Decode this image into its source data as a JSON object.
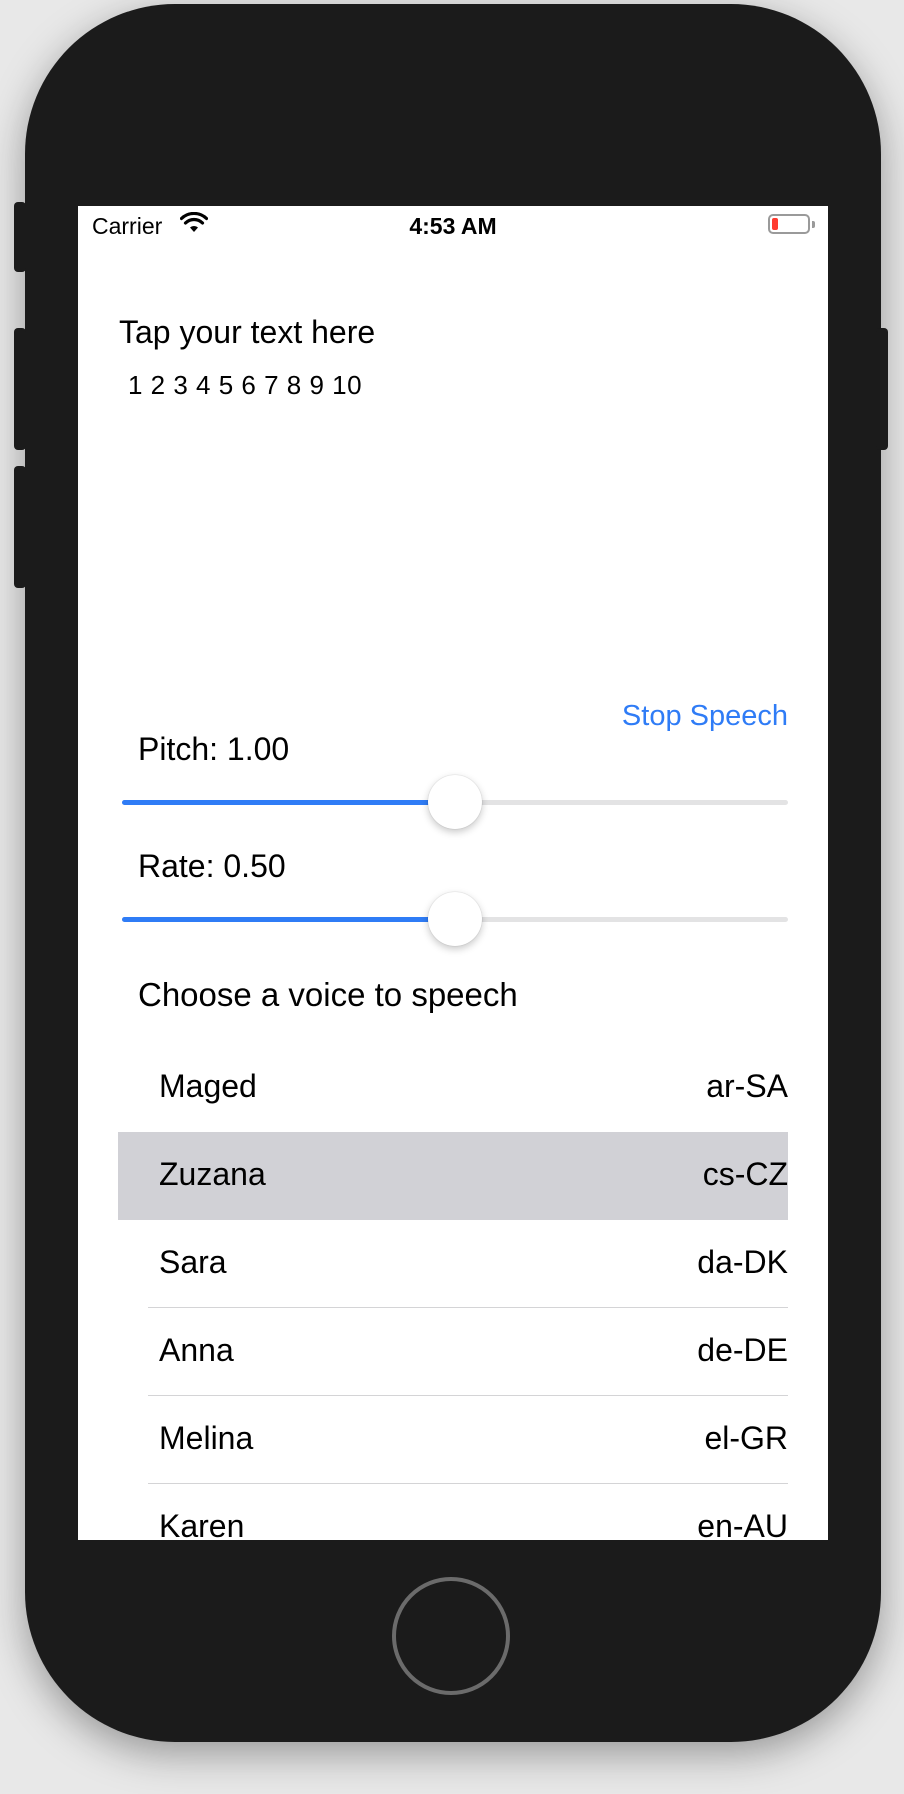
{
  "status_bar": {
    "carrier": "Carrier",
    "time": "4:53 AM"
  },
  "editor": {
    "prompt": "Tap your text here",
    "text": "1 2 3 4 5 6 7 8 9 10"
  },
  "actions": {
    "stop_label": "Stop Speech"
  },
  "pitch": {
    "label": "Pitch: 1.00",
    "value_fraction": 0.5
  },
  "rate": {
    "label": "Rate: 0.50",
    "value_fraction": 0.5
  },
  "voices": {
    "title": "Choose a voice to speech",
    "items": [
      {
        "name": "Maged",
        "code": "ar-SA"
      },
      {
        "name": "Zuzana",
        "code": "cs-CZ"
      },
      {
        "name": "Sara",
        "code": "da-DK"
      },
      {
        "name": "Anna",
        "code": "de-DE"
      },
      {
        "name": "Melina",
        "code": "el-GR"
      },
      {
        "name": "Karen",
        "code": "en-AU"
      }
    ],
    "selected_index": 1
  },
  "colors": {
    "accent": "#2f7cf6",
    "selected_row": "#d1d1d6",
    "device_frame": "#1b1b1b"
  },
  "icons": {
    "wifi": "wifi-icon",
    "battery": "battery-icon",
    "home": "home-button"
  }
}
